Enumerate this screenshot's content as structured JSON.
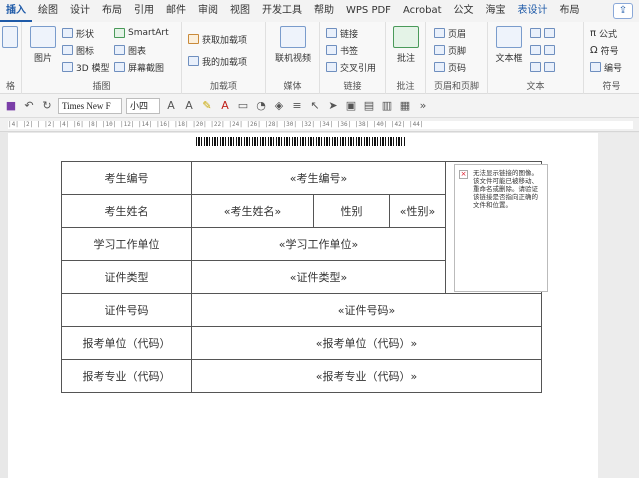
{
  "tabs": [
    "插入",
    "绘图",
    "设计",
    "布局",
    "引用",
    "邮件",
    "审阅",
    "视图",
    "开发工具",
    "帮助",
    "WPS PDF",
    "Acrobat",
    "公文",
    "海宝",
    "表设计",
    "布局"
  ],
  "ribbon": {
    "table_group_label": "格",
    "illustrations": {
      "picture": "图片",
      "shapes": "形状",
      "icons": "图标",
      "model3d": "3D 模型",
      "smartart": "SmartArt",
      "chart": "图表",
      "screenshot": "屏幕截图",
      "label": "插图"
    },
    "addins": {
      "get": "获取加载项",
      "mine": "我的加载项",
      "label": "加载项"
    },
    "media": {
      "video": "联机视频",
      "label": "媒体"
    },
    "links": {
      "link": "链接",
      "bookmark": "书签",
      "crossref": "交叉引用",
      "label": "链接"
    },
    "comments": {
      "comment": "批注",
      "label": "批注"
    },
    "header_footer": {
      "header": "页眉",
      "footer": "页脚",
      "page_number": "页码",
      "label": "页眉和页脚"
    },
    "text": {
      "textbox": "文本框",
      "label": "文本"
    },
    "symbols": {
      "equation": "公式",
      "symbol": "符号",
      "number": "编号",
      "label": "符号"
    }
  },
  "quickbar": {
    "font": "Times New F",
    "size": "小四"
  },
  "ruler": "  |4| |2| |  |2| |4| |6| |8| |10| |12| |14| |16| |18| |20| |22| |24| |26| |28| |30| |32| |34| |36| |38| |40| |42| |44|",
  "form": {
    "rows": [
      {
        "label": "考生编号",
        "value": "«考生编号»"
      },
      {
        "label": "考生姓名",
        "value": "«考生姓名»",
        "label2": "性别",
        "value2": "«性别»"
      },
      {
        "label": "学习工作单位",
        "value": "«学习工作单位»"
      },
      {
        "label": "证件类型",
        "value": "«证件类型»"
      },
      {
        "label": "证件号码",
        "value": "«证件号码»"
      },
      {
        "label": "报考单位（代码）",
        "value": "«报考单位（代码）»"
      },
      {
        "label": "报考专业（代码）",
        "value": "«报考专业（代码）»"
      }
    ],
    "image_placeholder": "无法显示链接的图像。该文件可能已被移动、重命名或删除。请验证该链接是否指向正确的文件和位置。"
  }
}
